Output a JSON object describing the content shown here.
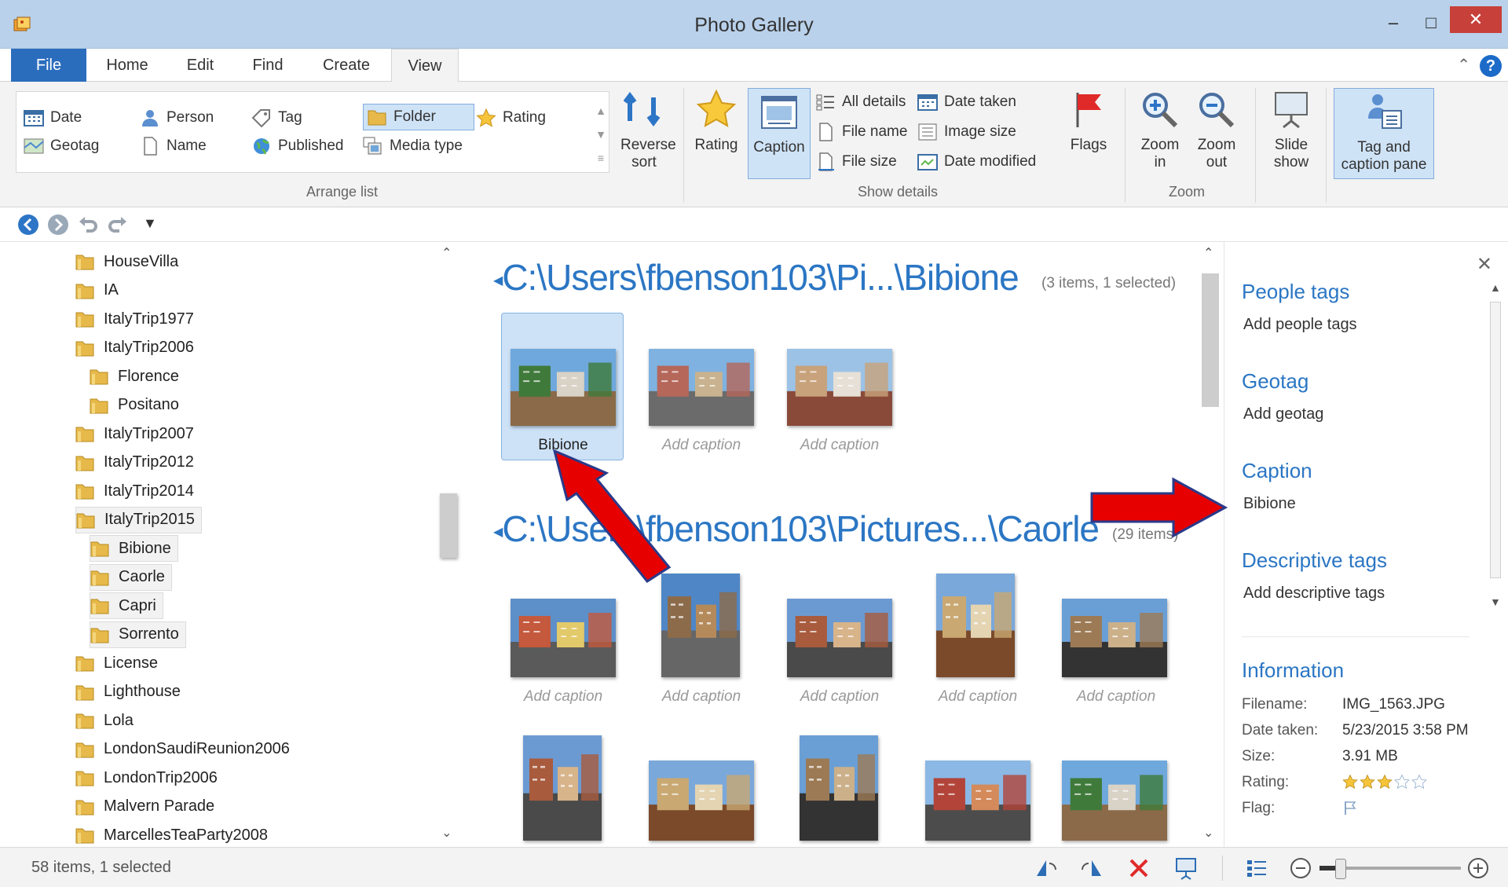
{
  "window": {
    "title": "Photo Gallery"
  },
  "ribbon_tabs": [
    "File",
    "Home",
    "Edit",
    "Find",
    "Create",
    "View"
  ],
  "active_tab": "View",
  "arrange_list": {
    "label": "Arrange list",
    "items": [
      "Date",
      "Person",
      "Tag",
      "Folder",
      "Rating",
      "Geotag",
      "Name",
      "Published",
      "Media type"
    ],
    "selected": "Folder",
    "reverse_sort": "Reverse sort"
  },
  "show_details": {
    "label": "Show details",
    "rating": "Rating",
    "caption": "Caption",
    "all_details": "All details",
    "date_taken": "Date taken",
    "file_name": "File name",
    "image_size": "Image size",
    "file_size": "File size",
    "date_modified": "Date modified",
    "flags": "Flags"
  },
  "zoom": {
    "label": "Zoom",
    "zoom_in": "Zoom in",
    "zoom_out": "Zoom out"
  },
  "slide_show": "Slide show",
  "tag_caption_pane": "Tag and caption pane",
  "folder_tree": [
    "HouseVilla",
    "IA",
    "ItalyTrip1977",
    "ItalyTrip2006",
    "Florence",
    "Positano",
    "ItalyTrip2007",
    "ItalyTrip2012",
    "ItalyTrip2014",
    "ItalyTrip2015",
    "Bibione",
    "Caorle",
    "Capri",
    "Sorrento",
    "License",
    "Lighthouse",
    "Lola",
    "LondonSaudiReunion2006",
    "LondonTrip2006",
    "Malvern Parade",
    "MarcellesTeaParty2008"
  ],
  "groups": [
    {
      "path": "C:\\Users\\fbenson103\\Pi...\\Bibione",
      "count": "(3 items, 1 selected)",
      "captions": [
        "Bibione",
        "Add caption",
        "Add caption"
      ]
    },
    {
      "path": "C:\\Users\\fbenson103\\Pictures...\\Caorle",
      "count": "(29 items)",
      "captions": [
        "Add caption",
        "Add caption",
        "Add caption",
        "Add caption",
        "Add caption"
      ]
    }
  ],
  "pane": {
    "people_tags": "People tags",
    "add_people_tags": "Add people tags",
    "geotag": "Geotag",
    "add_geotag": "Add geotag",
    "caption": "Caption",
    "caption_value": "Bibione",
    "descriptive_tags": "Descriptive tags",
    "add_descriptive_tags": "Add descriptive tags",
    "information": "Information",
    "info": [
      {
        "key": "Filename:",
        "value": "IMG_1563.JPG"
      },
      {
        "key": "Date taken:",
        "value": "5/23/2015  3:58 PM"
      },
      {
        "key": "Size:",
        "value": "3.91 MB"
      },
      {
        "key": "Rating:",
        "value": ""
      },
      {
        "key": "Flag:",
        "value": ""
      }
    ],
    "rating_stars": 3
  },
  "status": {
    "text": "58 items, 1 selected",
    "zoom_level": 0.15
  },
  "colors": {
    "accent": "#2b76c4",
    "file_tab": "#2b6dbd",
    "close": "#c7403a",
    "annotation_arrow": "#e60000"
  }
}
